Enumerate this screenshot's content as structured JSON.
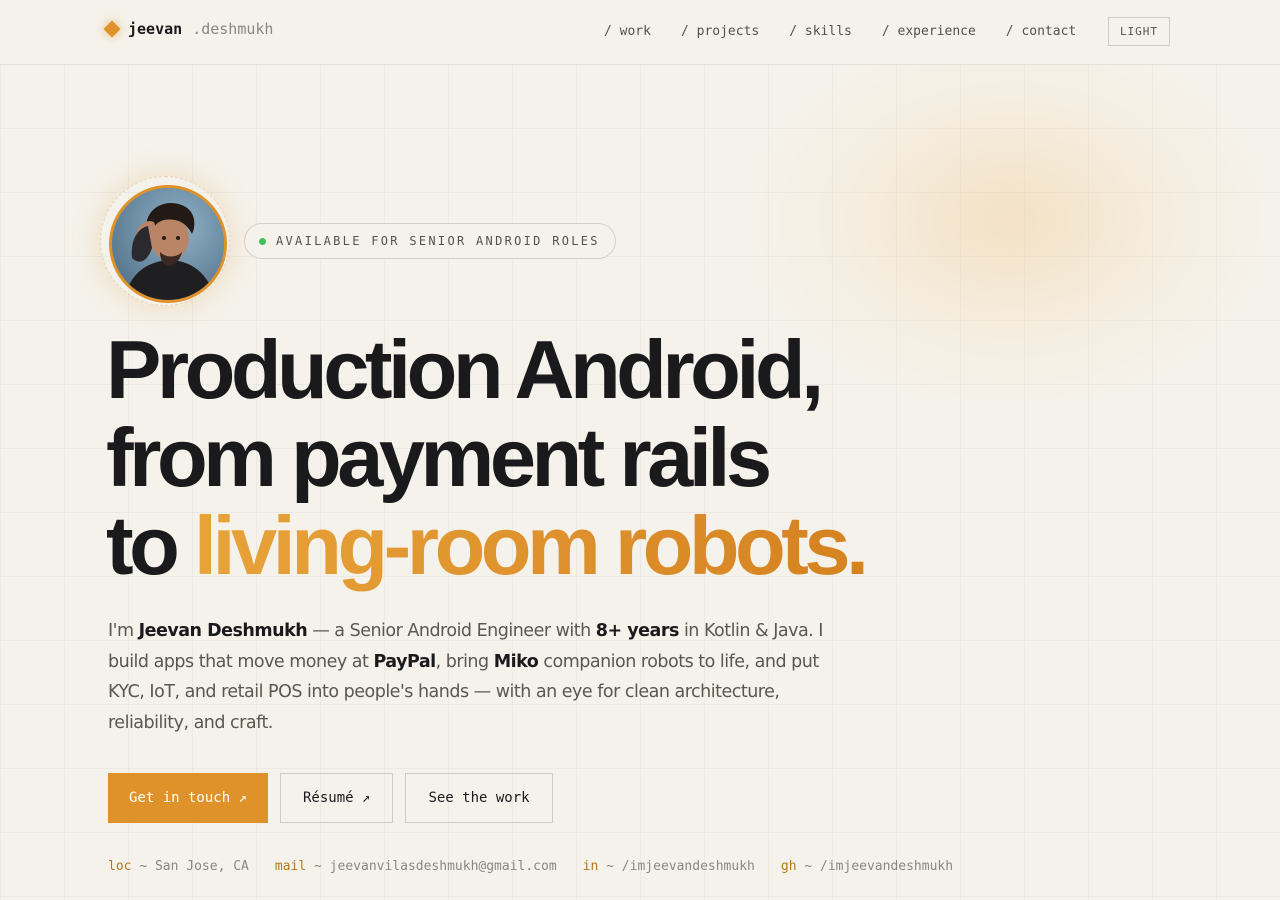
{
  "brand": {
    "first": "jeevan",
    "last": ".deshmukh"
  },
  "nav": {
    "items": [
      "/ work",
      "/ projects",
      "/ skills",
      "/ experience",
      "/ contact"
    ],
    "theme_toggle": "LIGHT"
  },
  "badge": {
    "text": "AVAILABLE FOR SENIOR ANDROID ROLES"
  },
  "hero": {
    "line1": "Production Android,",
    "line2": "from payment rails",
    "line3_prefix": "to ",
    "line3_accent": "living-room robots."
  },
  "intro": {
    "p1": "I'm ",
    "name": "Jeevan Deshmukh",
    "p2": " — a Senior Android Engineer with ",
    "years": "8+ years",
    "p3": " in Kotlin & Java. I build apps that move money at ",
    "company1": "PayPal",
    "p4": ", bring ",
    "company2": "Miko",
    "p5": " companion robots to life, and put KYC, IoT, and retail POS into people's hands — with an eye for clean architecture, reliability, and craft."
  },
  "actions": {
    "primary": "Get in touch ↗",
    "resume": "Résumé ↗",
    "work": "See the work"
  },
  "contact": [
    {
      "key": "loc",
      "value": "~ San Jose, CA"
    },
    {
      "key": "mail",
      "value": "~ jeevanvilasdeshmukh@gmail.com"
    },
    {
      "key": "in",
      "value": "~ /imjeevandeshmukh"
    },
    {
      "key": "gh",
      "value": "~ /imjeevandeshmukh"
    }
  ],
  "colors": {
    "accent": "#e0922a",
    "status": "#3fbf5b",
    "background": "#f5f2eb",
    "text": "#1a1a1c"
  }
}
